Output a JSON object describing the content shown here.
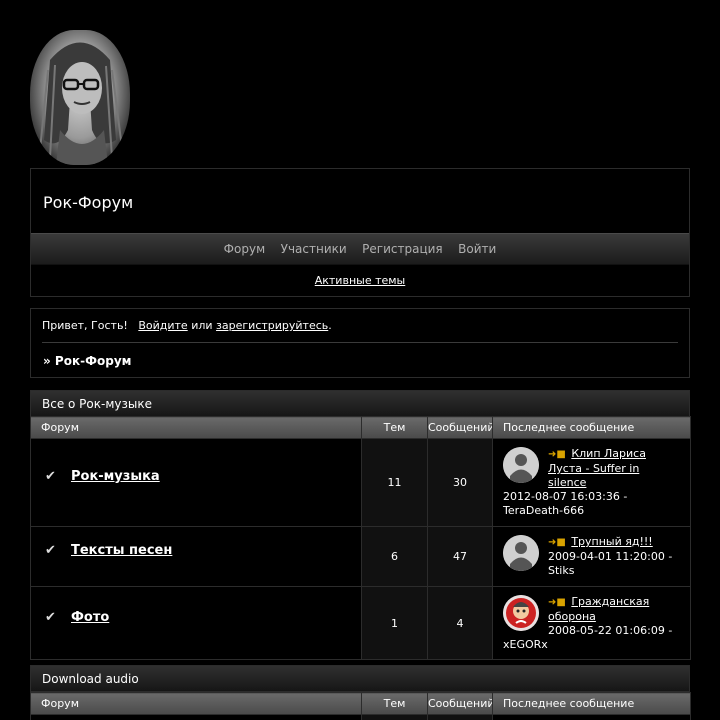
{
  "site": {
    "title": "Рок-Форум"
  },
  "nav": {
    "items": [
      "Форум",
      "Участники",
      "Регистрация",
      "Войти"
    ],
    "active_topics": "Активные темы"
  },
  "welcome": {
    "greeting": "Привет, Гость!",
    "login_link": "Войдите",
    "or_text": "или",
    "register_link": "зарегистрируйтесь",
    "period": ".",
    "breadcrumb": "» Рок-Форум"
  },
  "columns": {
    "forum": "Форум",
    "topics": "Тем",
    "posts": "Сообщений",
    "last_post": "Последнее сообщение"
  },
  "categories": [
    {
      "title": "Все о Рок-музыке",
      "forums": [
        {
          "name": "Рок-музыка",
          "topics": "11",
          "posts": "30",
          "last_title": "Клип Лариса Луста - Suffer in silence",
          "last_date": "2012-08-07 16:03:36 -",
          "last_user": "TeraDeath-666",
          "avatar": "default-user-icon"
        },
        {
          "name": "Тексты песен",
          "topics": "6",
          "posts": "47",
          "last_title": "Трупный яд!!!",
          "last_date": "2009-04-01 11:20:00 -",
          "last_user": "Stiks",
          "avatar": "default-user-icon"
        },
        {
          "name": "Фото",
          "topics": "1",
          "posts": "4",
          "last_title": "Гражданская оборона",
          "last_date": "2008-05-22 01:06:09 -",
          "last_user": "xEGORx",
          "avatar": "custom-avatar"
        }
      ]
    },
    {
      "title": "Download audio",
      "forums": []
    }
  ],
  "icons": {
    "forum_marker": "checkmark-icon",
    "last_post_marker": "go-to-post-icon"
  }
}
